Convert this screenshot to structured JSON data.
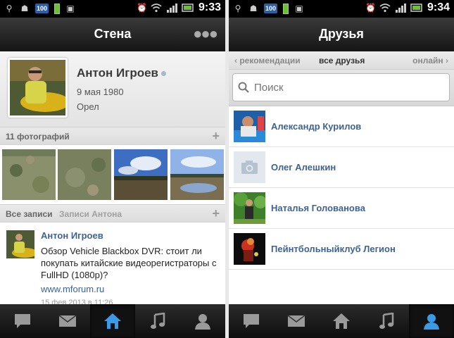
{
  "left": {
    "status": {
      "usb_badge": "100",
      "time": "9:33"
    },
    "header": {
      "title": "Стена",
      "menu_icon": "more-dots-icon"
    },
    "profile": {
      "name": "Антон Игроев",
      "birthday": "9 мая 1980",
      "city": "Орел"
    },
    "photos": {
      "label": "11 фотографий"
    },
    "wall": {
      "tab_all": "Все записи",
      "tab_own": "Записи Антона"
    },
    "post": {
      "author": "Антон Игроев",
      "text": "Обзор Vehicle Blackbox DVR: стоит ли покупать китайские видеорегистраторы с FullHD (1080p)?",
      "link": "www.mforum.ru",
      "date": "15 фев 2013 в 11:26"
    },
    "tabbar": {
      "active": "home"
    }
  },
  "right": {
    "status": {
      "usb_badge": "100",
      "time": "9:34"
    },
    "header": {
      "title": "Друзья"
    },
    "tabs": {
      "prev": "рекомендации",
      "current": "все друзья",
      "next": "онлайн"
    },
    "search": {
      "placeholder": "Поиск"
    },
    "friends": [
      {
        "name": "Александр Курилов"
      },
      {
        "name": "Олег Алешкин"
      },
      {
        "name": "Наталья Голованова"
      },
      {
        "name": "Пейнтбольныйклуб Легион"
      }
    ],
    "tabbar": {
      "active": "profile"
    }
  },
  "colors": {
    "link": "#3c6296",
    "tab_active": "#3a9ae8",
    "tab_icon": "#9a9a9a"
  }
}
